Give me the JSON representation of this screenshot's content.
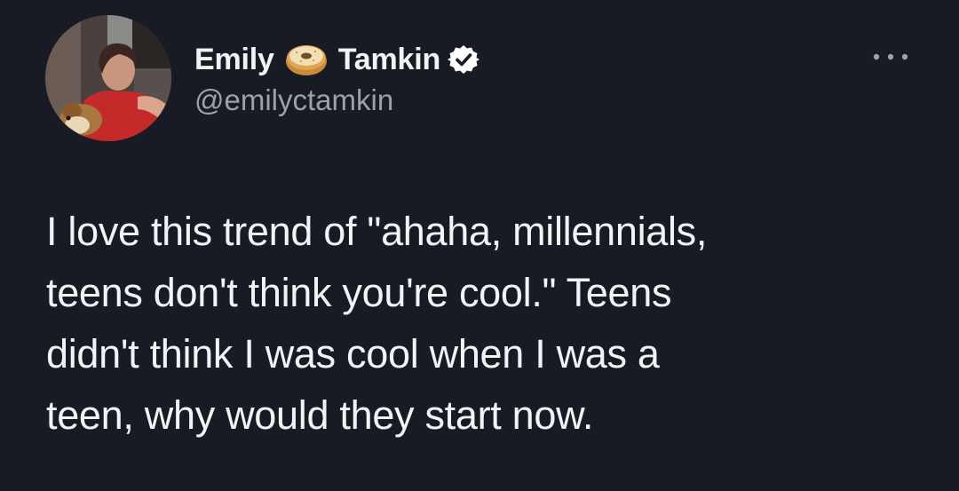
{
  "author": {
    "name_first": "Emily",
    "name_last": "Tamkin",
    "name_emoji": "bagel-emoji",
    "verified": true,
    "handle": "@emilyctamkin",
    "avatar": "profile-photo"
  },
  "tweet": {
    "lines": [
      "I love this trend of \"ahaha, millennials,",
      "teens don't think you're cool.\" Teens",
      "didn't think I was cool when I was a",
      "teen, why would they start now."
    ]
  },
  "menu": {
    "icon": "more-dots-icon"
  },
  "colors": {
    "background": "#181b24",
    "text": "#f2f3f5",
    "handle": "#9aa1aa",
    "verified": "#ffffff"
  }
}
